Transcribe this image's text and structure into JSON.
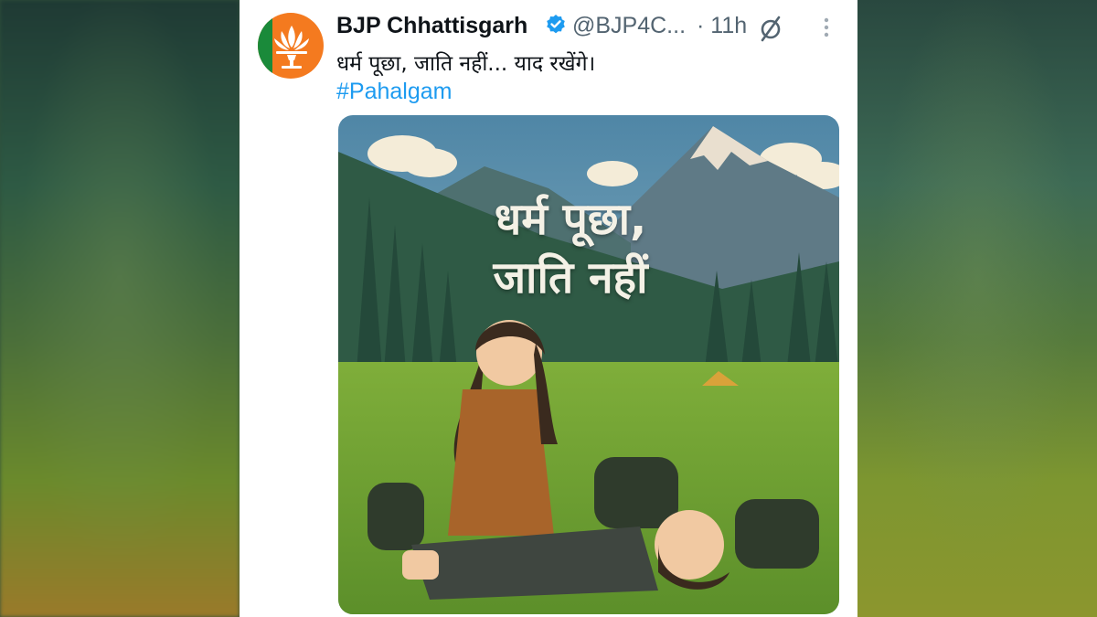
{
  "tweet": {
    "author_name": "BJP Chhattisgarh",
    "handle": "@BJP4C...",
    "time": "· 11h",
    "text": "धर्म पूछा, जाति नहीं... याद रखेंगे।",
    "hashtag": "#Pahalgam",
    "image_overlay": {
      "line1": "धर्म पूछा,",
      "line2": "जाति नहीं"
    }
  },
  "icons": {
    "verified": "verified-badge-icon",
    "grok": "grok-slash-icon",
    "more": "more-dots-icon"
  },
  "colors": {
    "accent": "#1d9bf0",
    "avatar_bg": "#f47a1f",
    "avatar_green": "#1a8a3a",
    "text": "#0f1419",
    "muted": "#536471"
  }
}
